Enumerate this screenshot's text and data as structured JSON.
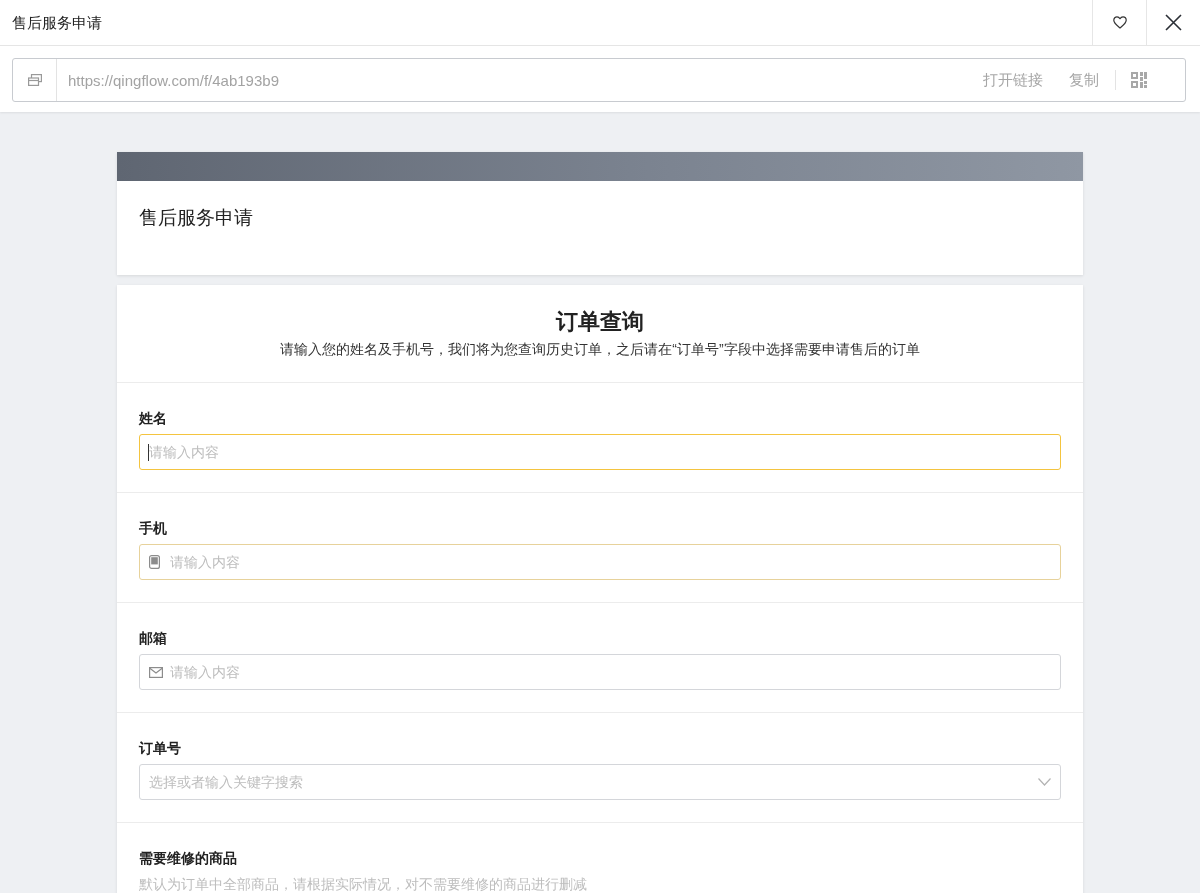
{
  "window": {
    "title": "售后服务申请"
  },
  "link_bar": {
    "url": "https://qingflow.com/f/4ab193b9",
    "actions": [
      "打开链接",
      "复制"
    ]
  },
  "form": {
    "title": "售后服务申请"
  },
  "section": {
    "title": "订单查询",
    "description": "请输入您的姓名及手机号，我们将为您查询历史订单，之后请在“订单号”字段中选择需要申请售后的订单"
  },
  "fields": [
    {
      "label": "姓名",
      "kind": "text",
      "placeholder": "请输入内容",
      "focused": true,
      "hovered": false
    },
    {
      "label": "手机",
      "kind": "phone",
      "placeholder": "请输入内容",
      "focused": false,
      "hovered": true
    },
    {
      "label": "邮箱",
      "kind": "email",
      "placeholder": "请输入内容",
      "focused": false,
      "hovered": false
    },
    {
      "label": "订单号",
      "kind": "select",
      "placeholder": "选择或者输入关键字搜索",
      "focused": false,
      "hovered": false
    },
    {
      "label": "需要维修的商品",
      "kind": "note",
      "hint": "默认为订单中全部商品，请根据实际情况，对不需要维修的商品进行删减"
    }
  ]
}
